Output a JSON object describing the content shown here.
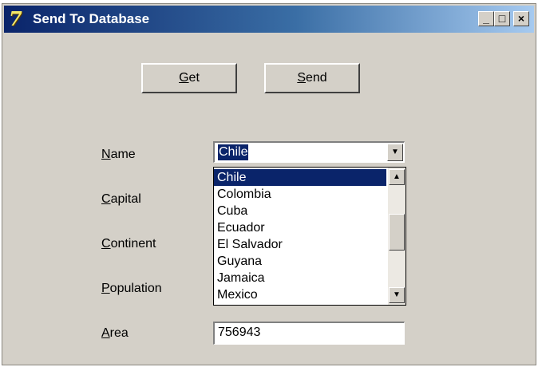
{
  "window": {
    "title": "Send To Database",
    "icon": "delphi-app-icon",
    "controls": {
      "minimize": "_",
      "maximize": "□",
      "close": "×"
    }
  },
  "buttons": {
    "get": {
      "accel": "G",
      "rest": "et"
    },
    "send": {
      "accel": "S",
      "rest": "end"
    }
  },
  "labels": {
    "name": {
      "accel": "N",
      "rest": "ame"
    },
    "capital": {
      "accel": "C",
      "rest": "apital"
    },
    "continent": {
      "accel": "C",
      "rest": "ontinent"
    },
    "population": {
      "accel": "P",
      "rest": "opulation"
    },
    "area": {
      "accel": "A",
      "rest": "rea"
    }
  },
  "name_combo": {
    "value": "Chile",
    "dropdown_arrow": "▼",
    "options": [
      "Chile",
      "Colombia",
      "Cuba",
      "Ecuador",
      "El Salvador",
      "Guyana",
      "Jamaica",
      "Mexico"
    ],
    "selected_index": 0,
    "scroll_up": "▲",
    "scroll_down": "▼"
  },
  "area_field": {
    "value": "756943"
  },
  "colors": {
    "titlebar_start": "#0a246a",
    "titlebar_end": "#a6caf0",
    "selection": "#0a246a",
    "face": "#d4d0c8"
  }
}
